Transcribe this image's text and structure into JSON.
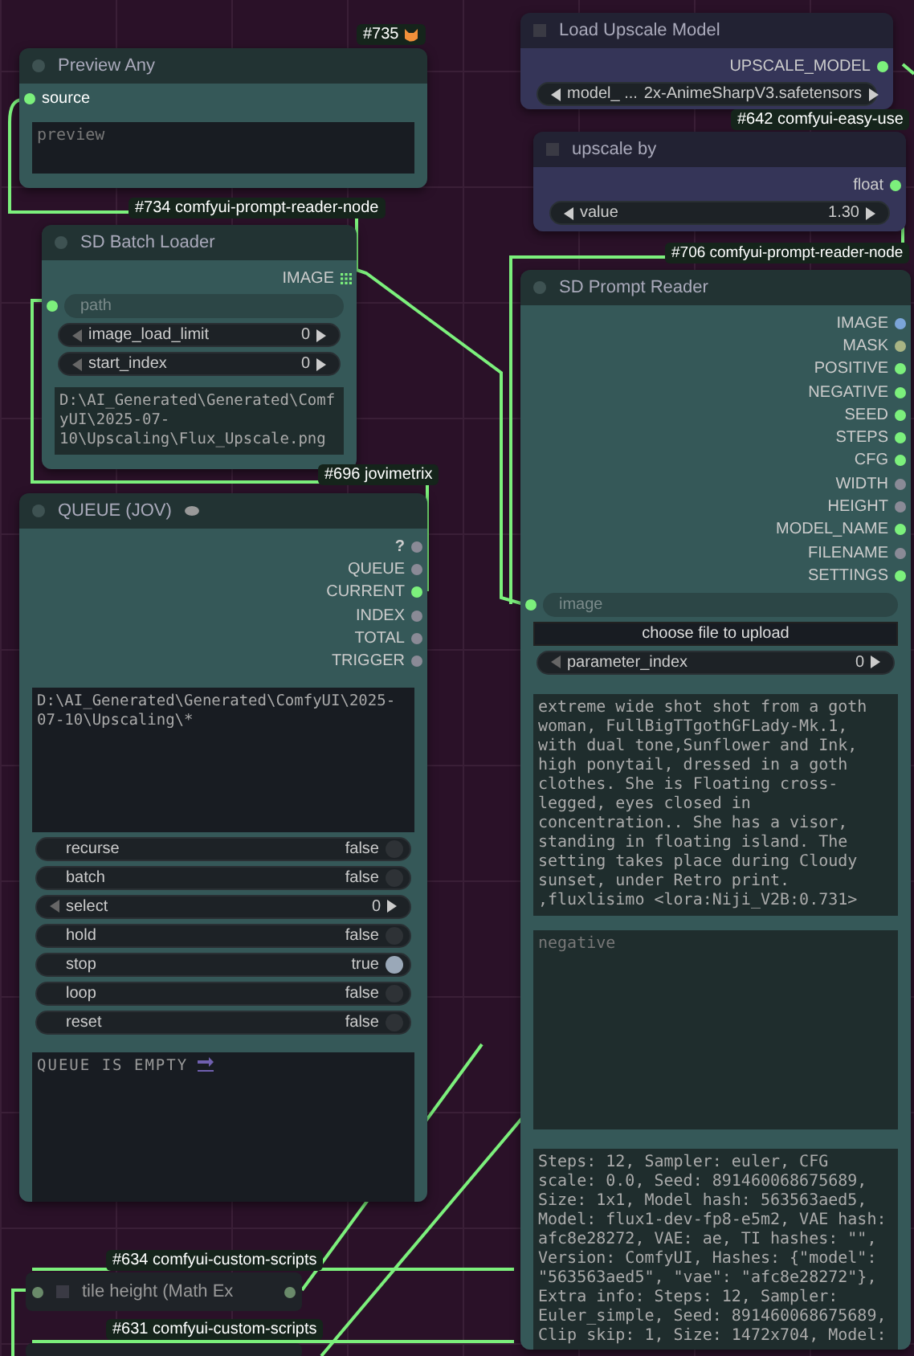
{
  "preview_any": {
    "badge": "#735",
    "title": "Preview Any",
    "input": "source",
    "placeholder": "preview"
  },
  "sd_batch_loader": {
    "badge": "#734 comfyui-prompt-reader-node",
    "title": "SD Batch Loader",
    "output": "IMAGE",
    "path_placeholder": "path",
    "widgets": [
      {
        "kind": "number",
        "label": "image_load_limit",
        "value": "0"
      },
      {
        "kind": "number",
        "label": "start_index",
        "value": "0"
      }
    ],
    "text": "D:\\AI_Generated\\Generated\\ComfyUI\\2025-07-10\\Upscaling\\Flux_Upscale.png"
  },
  "queue": {
    "badge": "#696 jovimetrix",
    "title": "QUEUE (JOV)",
    "outputs": [
      {
        "label": "?",
        "color": "#8a8a96"
      },
      {
        "label": "QUEUE",
        "color": "#8a8a96"
      },
      {
        "label": "CURRENT",
        "color": "#7cf07c"
      },
      {
        "label": "INDEX",
        "color": "#8a8a96"
      },
      {
        "label": "TOTAL",
        "color": "#8a8a96"
      },
      {
        "label": "TRIGGER",
        "color": "#8a8a96"
      }
    ],
    "text": "D:\\AI_Generated\\Generated\\ComfyUI\\2025-07-10\\Upscaling\\*",
    "widgets": [
      {
        "kind": "toggle",
        "label": "recurse",
        "value": "false",
        "on": false
      },
      {
        "kind": "toggle",
        "label": "batch",
        "value": "false",
        "on": false
      },
      {
        "kind": "number",
        "label": "select",
        "value": "0"
      },
      {
        "kind": "toggle",
        "label": "hold",
        "value": "false",
        "on": false
      },
      {
        "kind": "toggle",
        "label": "stop",
        "value": "true",
        "on": true
      },
      {
        "kind": "toggle",
        "label": "loop",
        "value": "false",
        "on": false
      },
      {
        "kind": "toggle",
        "label": "reset",
        "value": "false",
        "on": false
      }
    ],
    "log": "QUEUE IS EMPTY"
  },
  "load_upscale_model": {
    "title": "Load Upscale Model",
    "output": "UPSCALE_MODEL",
    "widgets": [
      {
        "kind": "combo",
        "label": "model_ ...",
        "value": "2x-AnimeSharpV3.safetensors"
      }
    ]
  },
  "upscale_by": {
    "badge": "#642 comfyui-easy-use",
    "title": "upscale by",
    "output": "float",
    "widgets": [
      {
        "kind": "number",
        "label": "value",
        "value": "1.30"
      }
    ]
  },
  "sd_prompt_reader": {
    "badge": "#706 comfyui-prompt-reader-node",
    "title": "SD Prompt Reader",
    "outputs": [
      {
        "label": "IMAGE",
        "color": "#7ba4d8"
      },
      {
        "label": "MASK",
        "color": "#a8b484"
      },
      {
        "label": "POSITIVE",
        "color": "#7cf07c"
      },
      {
        "label": "NEGATIVE",
        "color": "#7cf07c"
      },
      {
        "label": "SEED",
        "color": "#7cf07c"
      },
      {
        "label": "STEPS",
        "color": "#7cf07c"
      },
      {
        "label": "CFG",
        "color": "#7cf07c"
      },
      {
        "label": "WIDTH",
        "color": "#8a8a96"
      },
      {
        "label": "HEIGHT",
        "color": "#8a8a96"
      },
      {
        "label": "MODEL_NAME",
        "color": "#7cf07c"
      },
      {
        "label": "FILENAME",
        "color": "#8a8a96"
      },
      {
        "label": "SETTINGS",
        "color": "#7cf07c"
      }
    ],
    "image_placeholder": "image",
    "upload_button": "choose file to upload",
    "widgets": [
      {
        "kind": "number",
        "label": "parameter_index",
        "value": "0"
      }
    ],
    "positive": "extreme wide shot shot from a goth woman, FullBigTTgothGFLady-Mk.1, with dual tone,Sunflower and Ink,  high ponytail, dressed in a goth clothes. She is Floating cross-legged, eyes closed in concentration.. She has a visor, standing in floating island. The setting takes place during Cloudy sunset, under Retro print. ,fluxlisimo <lora:Niji_V2B:0.731>",
    "negative_placeholder": "negative",
    "settings": "Steps: 12, Sampler: euler, CFG scale: 0.0, Seed: 891460068675689, Size: 1x1, Model hash: 563563aed5, Model: flux1-dev-fp8-e5m2, VAE hash: afc8e28272, VAE: ae, TI hashes: \"\", Version: ComfyUI, Hashes: {\"model\": \"563563aed5\", \"vae\": \"afc8e28272\"}, Extra info: Steps: 12, Sampler: Euler_simple, Seed: 891460068675689, Clip skip: 1, Size: 1472x704, Model:"
  },
  "tile_height": {
    "badge": "#634 comfyui-custom-scripts",
    "title": "tile height (Math Ex"
  },
  "next_node": {
    "badge": "#631 comfyui-custom-scripts"
  }
}
